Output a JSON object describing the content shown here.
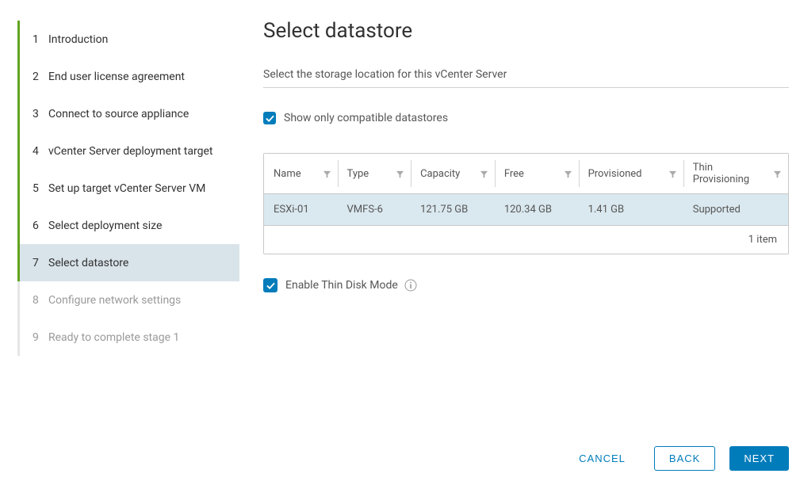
{
  "sidebar": {
    "steps": [
      {
        "num": "1",
        "label": "Introduction",
        "state": "done"
      },
      {
        "num": "2",
        "label": "End user license agreement",
        "state": "done"
      },
      {
        "num": "3",
        "label": "Connect to source appliance",
        "state": "done"
      },
      {
        "num": "4",
        "label": "vCenter Server deployment target",
        "state": "done"
      },
      {
        "num": "5",
        "label": "Set up target vCenter Server VM",
        "state": "done"
      },
      {
        "num": "6",
        "label": "Select deployment size",
        "state": "done"
      },
      {
        "num": "7",
        "label": "Select datastore",
        "state": "active"
      },
      {
        "num": "8",
        "label": "Configure network settings",
        "state": "disabled"
      },
      {
        "num": "9",
        "label": "Ready to complete stage 1",
        "state": "disabled"
      }
    ]
  },
  "main": {
    "title": "Select datastore",
    "subtitle": "Select the storage location for this vCenter Server",
    "compatibleCheckbox": {
      "checked": true,
      "label": "Show only compatible datastores"
    },
    "table": {
      "headers": [
        "Name",
        "Type",
        "Capacity",
        "Free",
        "Provisioned",
        "Thin Provisioning"
      ],
      "rows": [
        {
          "name": "ESXi-01",
          "type": "VMFS-6",
          "capacity": "121.75 GB",
          "free": "120.34 GB",
          "provisioned": "1.41 GB",
          "thin": "Supported"
        }
      ],
      "footer": "1 item"
    },
    "thinDisk": {
      "checked": true,
      "label": "Enable Thin Disk Mode"
    }
  },
  "footer": {
    "cancel": "CANCEL",
    "back": "BACK",
    "next": "NEXT"
  }
}
